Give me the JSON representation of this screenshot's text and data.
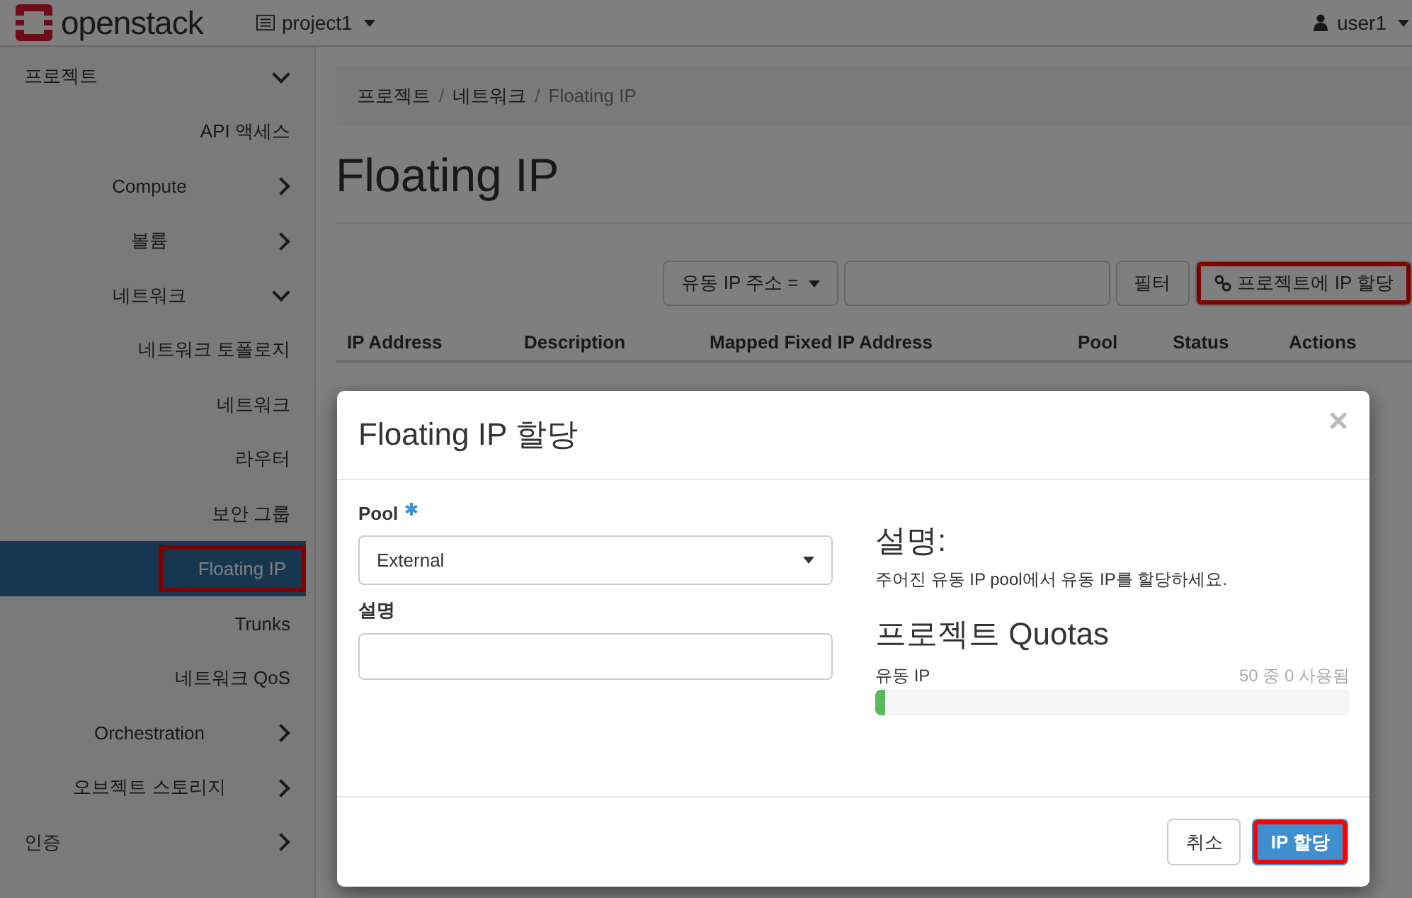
{
  "header": {
    "brand": "openstack",
    "project": "project1",
    "user": "user1"
  },
  "sidebar": {
    "items": [
      {
        "label": "프로젝트",
        "expanded": true,
        "children": [
          {
            "label": "API 액세스",
            "kind": "link",
            "selected": false,
            "highlighted": false
          },
          {
            "label": "Compute",
            "kind": "group",
            "expanded": false
          },
          {
            "label": "볼륨",
            "kind": "group",
            "expanded": false
          },
          {
            "label": "네트워크",
            "kind": "group",
            "expanded": true,
            "children": [
              {
                "label": "네트워크 토폴로지",
                "selected": false,
                "highlighted": false
              },
              {
                "label": "네트워크",
                "selected": false,
                "highlighted": false
              },
              {
                "label": "라우터",
                "selected": false,
                "highlighted": false
              },
              {
                "label": "보안 그룹",
                "selected": false,
                "highlighted": false
              },
              {
                "label": "Floating IP",
                "selected": true,
                "highlighted": true
              },
              {
                "label": "Trunks",
                "selected": false,
                "highlighted": false
              },
              {
                "label": "네트워크 QoS",
                "selected": false,
                "highlighted": false
              }
            ]
          },
          {
            "label": "Orchestration",
            "kind": "group",
            "expanded": false
          },
          {
            "label": "오브젝트 스토리지",
            "kind": "group",
            "expanded": false
          }
        ]
      },
      {
        "label": "인증",
        "expanded": false
      }
    ]
  },
  "breadcrumb": [
    {
      "label": "프로젝트",
      "separator": "/"
    },
    {
      "label": "네트워크",
      "separator": "/"
    },
    {
      "label": "Floating IP"
    }
  ],
  "page_title": "Floating IP",
  "toolbar": {
    "filter_field": "유동 IP 주소 =",
    "filter_button": "필터",
    "allocate_button": {
      "label": "프로젝트에 IP 할당",
      "highlighted": true
    }
  },
  "table": {
    "columns": [
      "IP Address",
      "Description",
      "Mapped Fixed IP Address",
      "Pool",
      "Status",
      "Actions"
    ]
  },
  "modal": {
    "title": "Floating IP 할당",
    "close": "×",
    "fields": [
      {
        "label": "Pool",
        "required": true,
        "kind": "select",
        "value": "External"
      },
      {
        "label": "설명",
        "required": false,
        "kind": "text"
      }
    ],
    "help_title": "설명:",
    "help_text": "주어진 유동 IP pool에서 유동 IP를 할당하세요.",
    "quota_title": "프로젝트 Quotas",
    "quotas": [
      {
        "name": "유동 IP",
        "reading": "50 중 0 사용됨",
        "level": 0.02
      }
    ],
    "buttons": [
      {
        "label": "취소",
        "kind": "default",
        "highlighted": false
      },
      {
        "label": "IP 할당",
        "kind": "primary",
        "highlighted": true
      }
    ]
  }
}
